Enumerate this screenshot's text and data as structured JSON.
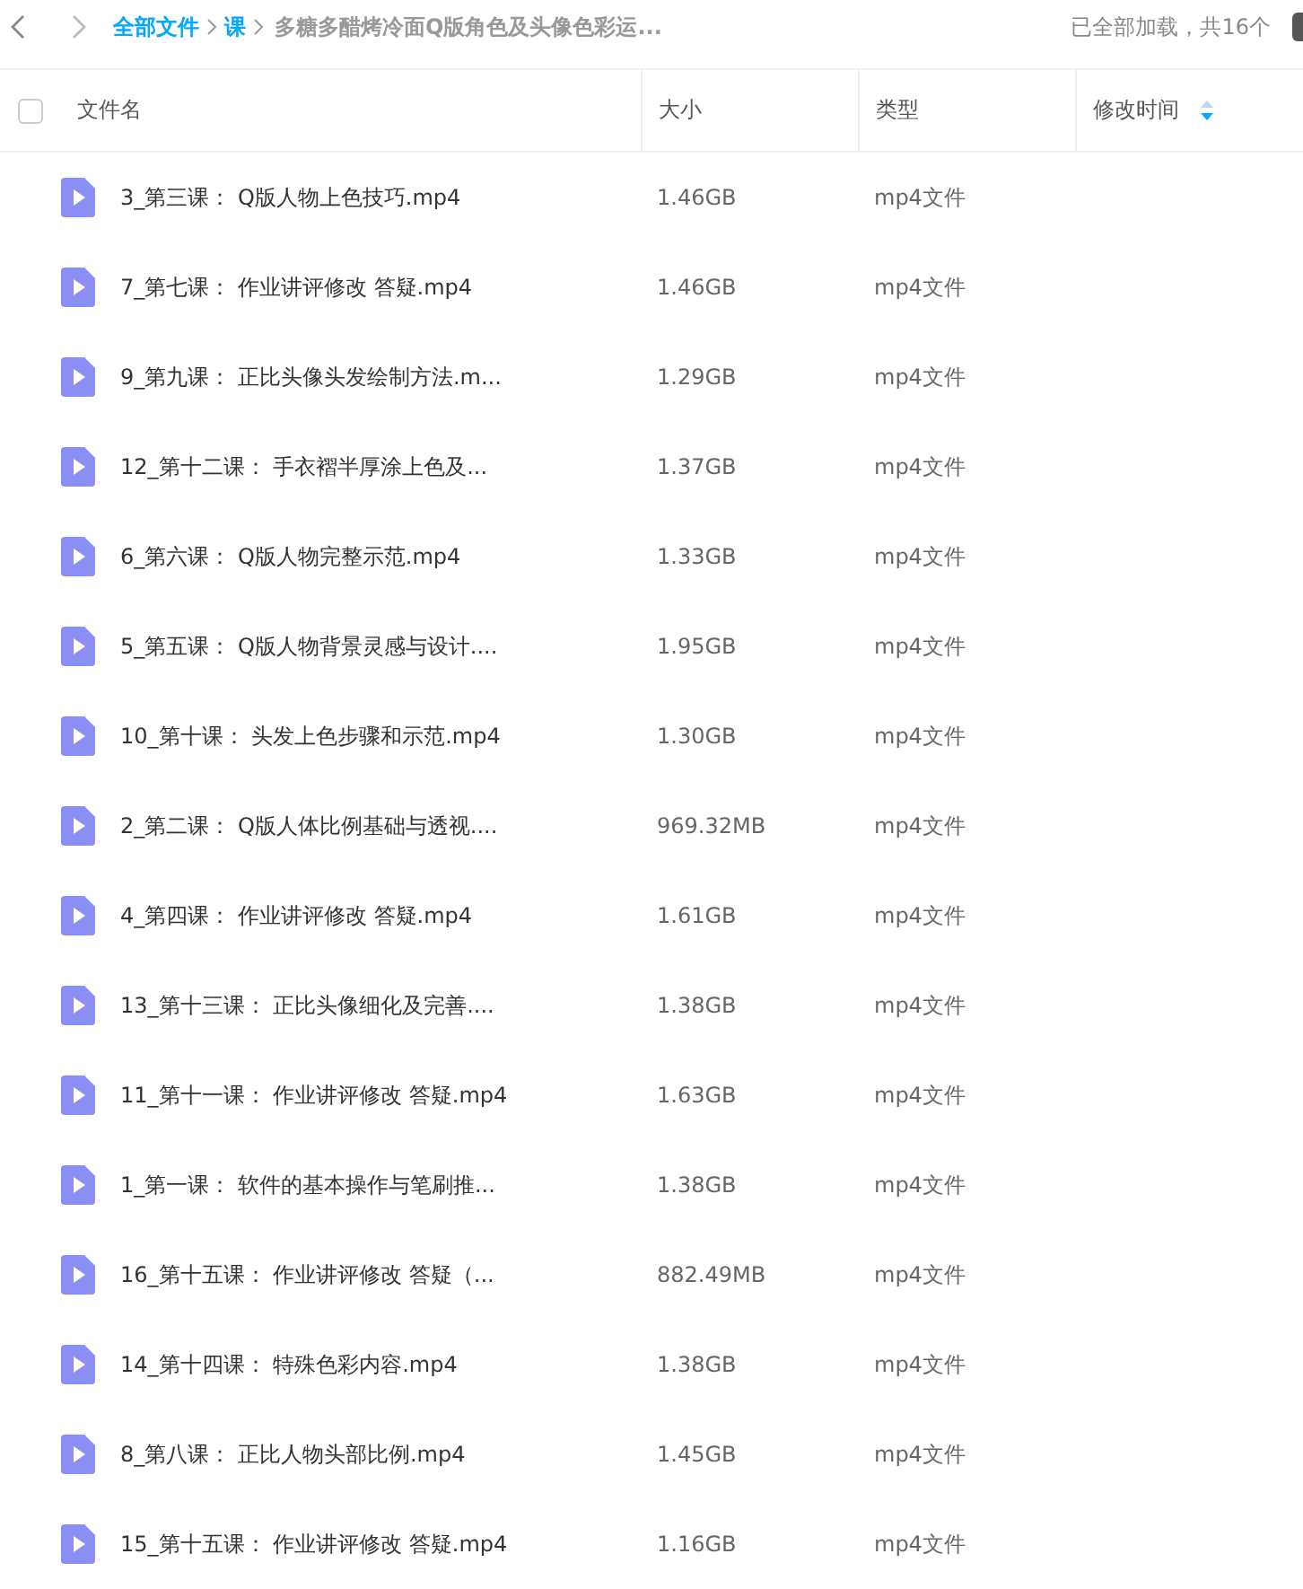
{
  "breadcrumb": [
    {
      "label": "全部文件",
      "kind": "link"
    },
    {
      "label": "课",
      "kind": "link"
    },
    {
      "label": "多糖多醋烤冷面Q版角色及头像色彩运...",
      "kind": "current"
    }
  ],
  "status": "已全部加载，共16个",
  "table": {
    "select_all": {
      "checked": false
    },
    "columns": [
      {
        "label": "文件名",
        "sortable": false
      },
      {
        "label": "大小",
        "sortable": false
      },
      {
        "label": "类型",
        "sortable": false
      },
      {
        "label": "修改时间",
        "sortable": true
      }
    ],
    "rows": [
      {
        "name": "3_第三课： Q版人物上色技巧.mp4",
        "size": "1.46GB",
        "type": "mp4文件"
      },
      {
        "name": "7_第七课： 作业讲评修改 答疑.mp4",
        "size": "1.46GB",
        "type": "mp4文件"
      },
      {
        "name": "9_第九课： 正比头像头发绘制方法.m...",
        "size": "1.29GB",
        "type": "mp4文件"
      },
      {
        "name": "12_第十二课： 手衣褶半厚涂上色及...",
        "size": "1.37GB",
        "type": "mp4文件"
      },
      {
        "name": "6_第六课： Q版人物完整示范.mp4",
        "size": "1.33GB",
        "type": "mp4文件"
      },
      {
        "name": "5_第五课： Q版人物背景灵感与设计....",
        "size": "1.95GB",
        "type": "mp4文件"
      },
      {
        "name": "10_第十课： 头发上色步骤和示范.mp4",
        "size": "1.30GB",
        "type": "mp4文件"
      },
      {
        "name": "2_第二课： Q版人体比例基础与透视....",
        "size": "969.32MB",
        "type": "mp4文件"
      },
      {
        "name": "4_第四课： 作业讲评修改 答疑.mp4",
        "size": "1.61GB",
        "type": "mp4文件"
      },
      {
        "name": "13_第十三课： 正比头像细化及完善....",
        "size": "1.38GB",
        "type": "mp4文件"
      },
      {
        "name": "11_第十一课： 作业讲评修改 答疑.mp4",
        "size": "1.63GB",
        "type": "mp4文件"
      },
      {
        "name": "1_第一课： 软件的基本操作与笔刷推...",
        "size": "1.38GB",
        "type": "mp4文件"
      },
      {
        "name": "16_第十五课： 作业讲评修改 答疑（...",
        "size": "882.49MB",
        "type": "mp4文件"
      },
      {
        "name": "14_第十四课： 特殊色彩内容.mp4",
        "size": "1.38GB",
        "type": "mp4文件"
      },
      {
        "name": "8_第八课： 正比人物头部比例.mp4",
        "size": "1.45GB",
        "type": "mp4文件"
      },
      {
        "name": "15_第十五课： 作业讲评修改 答疑.mp4",
        "size": "1.16GB",
        "type": "mp4文件"
      }
    ]
  }
}
